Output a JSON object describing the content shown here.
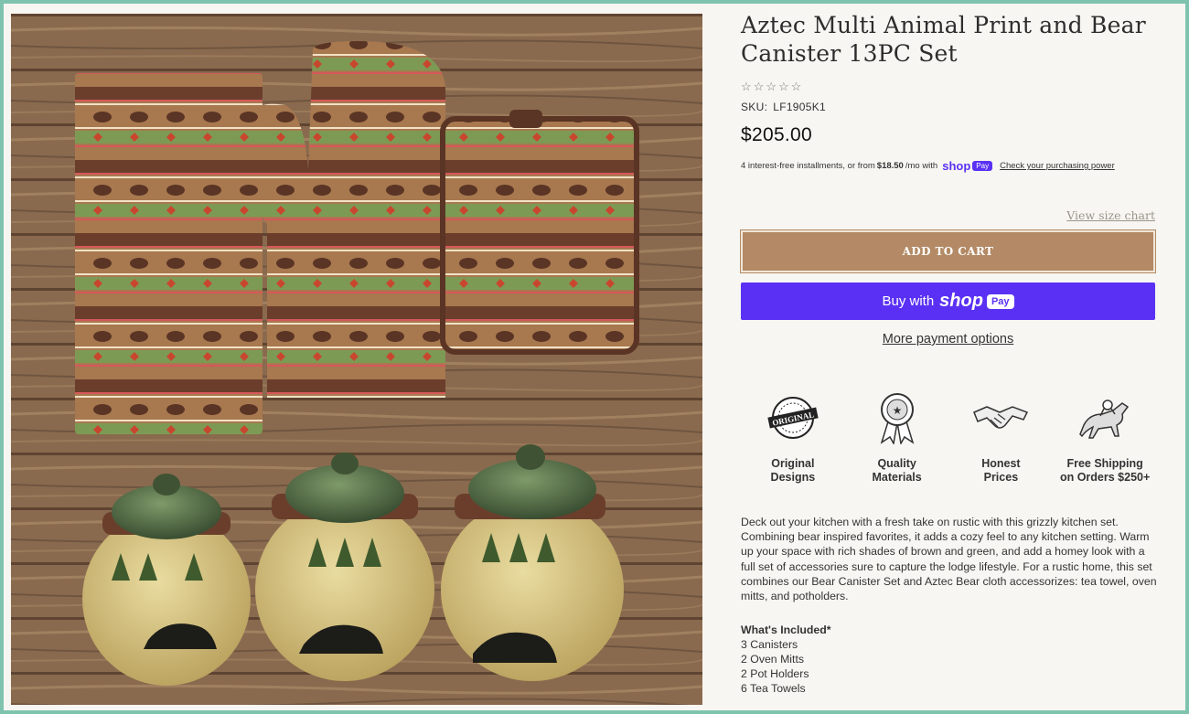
{
  "product": {
    "title_line1": "Aztec Multi Animal Print and Bear",
    "title_line2": "Canister 13PC Set",
    "rating_stars": [
      "☆",
      "☆",
      "☆",
      "☆",
      "☆"
    ],
    "sku_label": "SKU:",
    "sku_value": "LF1905K1",
    "price": "$205.00"
  },
  "installments": {
    "text_before": "4 interest-free installments, or from",
    "amount": "$18.50",
    "text_after": "/mo with",
    "shop_logo": "shop",
    "pay_badge": "Pay",
    "check_link": "Check your purchasing power"
  },
  "actions": {
    "size_chart": "View size chart",
    "add_to_cart": "ADD TO CART",
    "buy_with": "Buy with",
    "shop_word": "shop",
    "pay_chip": "Pay",
    "more_options": "More payment options"
  },
  "badges": [
    {
      "line1": "Original",
      "line2": "Designs",
      "icon": "original-seal-icon"
    },
    {
      "line1": "Quality",
      "line2": "Materials",
      "icon": "ribbon-award-icon"
    },
    {
      "line1": "Honest",
      "line2": "Prices",
      "icon": "handshake-icon"
    },
    {
      "line1": "Free Shipping",
      "line2": "on Orders $250+",
      "icon": "pony-express-icon"
    }
  ],
  "description": "Deck out your kitchen with a fresh take on rustic with this grizzly kitchen set. Combining bear inspired favorites, it adds a cozy feel to any kitchen setting. Warm up your space with rich shades of brown and green, and add a homey look with a full set of accessories sure to capture the lodge lifestyle. For a rustic home, this set combines our Bear Canister Set and Aztec Bear cloth accessorizes: tea towel, oven mitts, and potholders.",
  "included": {
    "heading": "What's Included*",
    "items": [
      "3 Canisters",
      "2 Oven Mitts",
      "2 Pot Holders",
      "6 Tea Towels"
    ]
  },
  "colors": {
    "accent_brown": "#b38a65",
    "shop_pay_purple": "#5a31f4",
    "frame_teal": "#7fc3ae"
  }
}
